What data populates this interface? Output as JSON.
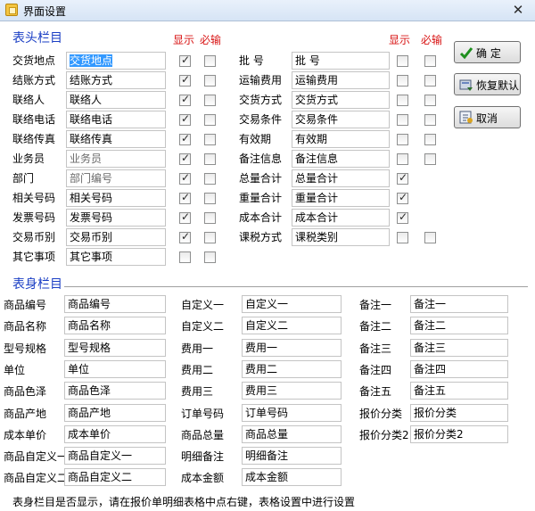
{
  "window": {
    "title": "界面设置",
    "close_glyph": "✕"
  },
  "header_section": {
    "title": "表头栏目",
    "col_show": "显示",
    "col_required": "必输",
    "left_rows": [
      {
        "label": "交货地点",
        "value": "交货地点",
        "show": true,
        "required": false,
        "selected": true,
        "muted": false
      },
      {
        "label": "结账方式",
        "value": "结账方式",
        "show": true,
        "required": false,
        "selected": false,
        "muted": false
      },
      {
        "label": "联络人",
        "value": "联络人",
        "show": true,
        "required": false,
        "selected": false,
        "muted": false
      },
      {
        "label": "联络电话",
        "value": "联络电话",
        "show": true,
        "required": false,
        "selected": false,
        "muted": false
      },
      {
        "label": "联络传真",
        "value": "联络传真",
        "show": true,
        "required": false,
        "selected": false,
        "muted": false
      },
      {
        "label": "业务员",
        "value": "业务员",
        "show": true,
        "required": false,
        "selected": false,
        "muted": true
      },
      {
        "label": "部门",
        "value": "部门编号",
        "show": true,
        "required": false,
        "selected": false,
        "muted": true
      },
      {
        "label": "相关号码",
        "value": "相关号码",
        "show": true,
        "required": false,
        "selected": false,
        "muted": false
      },
      {
        "label": "发票号码",
        "value": "发票号码",
        "show": true,
        "required": false,
        "selected": false,
        "muted": false
      },
      {
        "label": "交易币别",
        "value": "交易币别",
        "show": true,
        "required": false,
        "selected": false,
        "muted": false
      },
      {
        "label": "其它事项",
        "value": "其它事项",
        "show": false,
        "required": false,
        "selected": false,
        "muted": false
      }
    ],
    "right_rows": [
      {
        "label": "批  号",
        "value": "批      号",
        "show": false,
        "required": false
      },
      {
        "label": "运输费用",
        "value": "运输费用",
        "show": false,
        "required": false
      },
      {
        "label": "交货方式",
        "value": "交货方式",
        "show": false,
        "required": false
      },
      {
        "label": "交易条件",
        "value": "交易条件",
        "show": false,
        "required": false
      },
      {
        "label": "有效期",
        "value": "有效期",
        "show": false,
        "required": false
      },
      {
        "label": "备注信息",
        "value": "备注信息",
        "show": false,
        "required": false
      },
      {
        "label": "总量合计",
        "value": "总量合计",
        "show": true,
        "required": null
      },
      {
        "label": "重量合计",
        "value": "重量合计",
        "show": true,
        "required": null
      },
      {
        "label": "成本合计",
        "value": "成本合计",
        "show": true,
        "required": null
      },
      {
        "label": "课税方式",
        "value": "课税类别",
        "show": false,
        "required": false
      }
    ]
  },
  "body_section": {
    "title": "表身栏目",
    "col1": [
      {
        "label": "商品编号",
        "value": "商品编号"
      },
      {
        "label": "商品名称",
        "value": "商品名称"
      },
      {
        "label": "型号规格",
        "value": "型号规格"
      },
      {
        "label": "单位",
        "value": "单位"
      },
      {
        "label": "商品色泽",
        "value": "商品色泽"
      },
      {
        "label": "商品产地",
        "value": "商品产地"
      },
      {
        "label": "成本单价",
        "value": "成本单价"
      },
      {
        "label": "商品自定义一",
        "value": "商品自定义一"
      },
      {
        "label": "商品自定义二",
        "value": "商品自定义二"
      }
    ],
    "col2": [
      {
        "label": "自定义一",
        "value": "自定义一"
      },
      {
        "label": "自定义二",
        "value": "自定义二"
      },
      {
        "label": "费用一",
        "value": "费用一"
      },
      {
        "label": "费用二",
        "value": "费用二"
      },
      {
        "label": "费用三",
        "value": "费用三"
      },
      {
        "label": "订单号码",
        "value": "订单号码"
      },
      {
        "label": "商品总量",
        "value": "商品总量"
      },
      {
        "label": "明细备注",
        "value": "明细备注"
      },
      {
        "label": "成本金额",
        "value": "成本金额"
      }
    ],
    "col3": [
      {
        "label": "备注一",
        "value": "备注一"
      },
      {
        "label": "备注二",
        "value": "备注二"
      },
      {
        "label": "备注三",
        "value": "备注三"
      },
      {
        "label": "备注四",
        "value": "备注四"
      },
      {
        "label": "备注五",
        "value": "备注五"
      },
      {
        "label": "报价分类",
        "value": "报价分类"
      },
      {
        "label": "报价分类2",
        "value": "报价分类2"
      }
    ]
  },
  "buttons": {
    "ok": "确   定",
    "restore": "恢复默认",
    "cancel": "取消"
  },
  "footer_note": "表身栏目是否显示，请在报价单明细表格中点右键，表格设置中进行设置",
  "colors": {
    "section_title": "#1a3ec4",
    "column_header": "#d81414",
    "selection": "#3399ff"
  }
}
